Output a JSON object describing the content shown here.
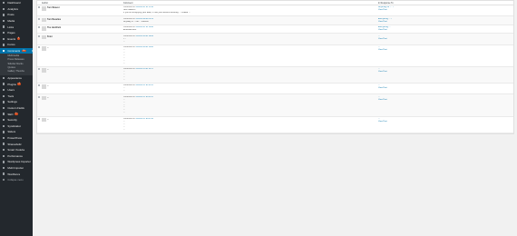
{
  "sidebar": {
    "items": [
      {
        "label": "Dashboard",
        "icon": "dashboard-icon"
      },
      {
        "label": "Analytics",
        "icon": "chart-icon"
      },
      {
        "label": "Posts",
        "icon": "pin-icon"
      },
      {
        "label": "Media",
        "icon": "media-icon"
      },
      {
        "label": "Links",
        "icon": "link-icon"
      },
      {
        "label": "Pages",
        "icon": "page-icon"
      },
      {
        "label": "Events",
        "icon": "calendar-icon",
        "badge": "5"
      },
      {
        "label": "Forms",
        "icon": "form-icon"
      },
      {
        "label": "Comments",
        "icon": "comment-icon",
        "badge": "16",
        "current": true
      }
    ],
    "submenu": [
      {
        "label": "Multimedia"
      },
      {
        "label": "Press Releases"
      },
      {
        "label": "Sidebar blocks"
      },
      {
        "label": "Quotes"
      },
      {
        "label": "Gallery Thumbs"
      }
    ],
    "items_after": [
      {
        "label": "Appearance",
        "icon": "brush-icon"
      },
      {
        "label": "Plugins",
        "icon": "plugin-icon",
        "badge": "4"
      },
      {
        "label": "Users",
        "icon": "users-icon"
      },
      {
        "label": "Tools",
        "icon": "tools-icon"
      },
      {
        "label": "Settings",
        "icon": "settings-icon"
      },
      {
        "label": "Custom Fields",
        "icon": "fields-icon"
      },
      {
        "label": "SEO",
        "icon": "seo-icon",
        "badge": "1"
      },
      {
        "label": "Security",
        "icon": "shield-icon"
      },
      {
        "label": "Syndication",
        "icon": "feed-icon"
      },
      {
        "label": "Sliders",
        "icon": "slider-icon"
      },
      {
        "label": "PowerPress",
        "icon": "mic-icon"
      },
      {
        "label": "Shareaholic",
        "icon": "share-icon"
      },
      {
        "label": "Smart Youtube",
        "icon": "video-icon"
      },
      {
        "label": "Performance",
        "icon": "gauge-icon"
      },
      {
        "label": "Wordpress Importer",
        "icon": "import-icon"
      },
      {
        "label": "Multi Importer",
        "icon": "import-icon"
      },
      {
        "label": "Wordfence",
        "icon": "wordfence-icon"
      }
    ],
    "collapse_label": "Collapse menu"
  },
  "table": {
    "headers": [
      "Author",
      "",
      "Comment",
      "In Response To"
    ],
    "rows": [
      {
        "author": "Tom Weaver",
        "ip": "",
        "status": "",
        "submitted": "Submitted on",
        "stamp": "2014/07/07 at 12:35",
        "body": [
          "Nick Geaorin",
          "If you're re-enjoying your deal, I'll find your actions seriously, ... indeed ..."
        ],
        "response": "Anything for ... ?",
        "view": "View Post"
      },
      {
        "author": "Tom Beaulieu",
        "ip": "",
        "status": "",
        "submitted": "Submitted on",
        "stamp": "2014/07/08 at 03:24",
        "body": [
          "Anyway, a ... the ... interest"
        ],
        "response": "Everything ... ?",
        "view": "View Post"
      },
      {
        "author": "The Hackfield",
        "ip": "",
        "status": "",
        "submitted": "Submitted on",
        "stamp": "2014/07/07 at 19:50",
        "body": [
          "Entertainment"
        ],
        "response": "Everything ...",
        "view": "View Post"
      },
      {
        "author": "Peter",
        "ip": "",
        "status": "",
        "submitted": "Submitted on",
        "stamp": "2014/07/09 at 18:06",
        "body": [
          "I ...",
          "..."
        ],
        "response": "...",
        "view": "View Post"
      },
      {
        "author": "...",
        "ip": "",
        "status": "",
        "submitted": "Submitted on",
        "stamp": "2014/07/09 at 15:00",
        "body": [
          "...",
          "...",
          "...",
          "...",
          "...",
          "..."
        ],
        "response": "...",
        "view": "View Post"
      },
      {
        "author": "...",
        "ip": "",
        "status": "",
        "submitted": "Submitted on",
        "stamp": "2014/07/10 at 10:21",
        "body": [
          "...",
          "...",
          "...",
          "..."
        ],
        "response": "...",
        "view": "View Post"
      },
      {
        "author": "...",
        "ip": "",
        "status": "",
        "submitted": "Submitted on",
        "stamp": "2014/07/11 at 10:25",
        "body": [
          "...",
          "..."
        ],
        "response": "...",
        "view": "View Post"
      },
      {
        "author": "...",
        "ip": "",
        "status": "",
        "submitted": "Submitted on",
        "stamp": "2014/07/11 at 05:31",
        "body": [
          "...",
          "...",
          "...",
          "...",
          "...",
          "..."
        ],
        "response": "...",
        "view": "View Post"
      },
      {
        "author": "...",
        "ip": "",
        "status": "",
        "submitted": "Submitted on",
        "stamp": "2014/07/11 at 02:33",
        "body": [
          "...",
          "...",
          "...",
          "..."
        ],
        "response": "...",
        "view": "View Post"
      }
    ]
  }
}
